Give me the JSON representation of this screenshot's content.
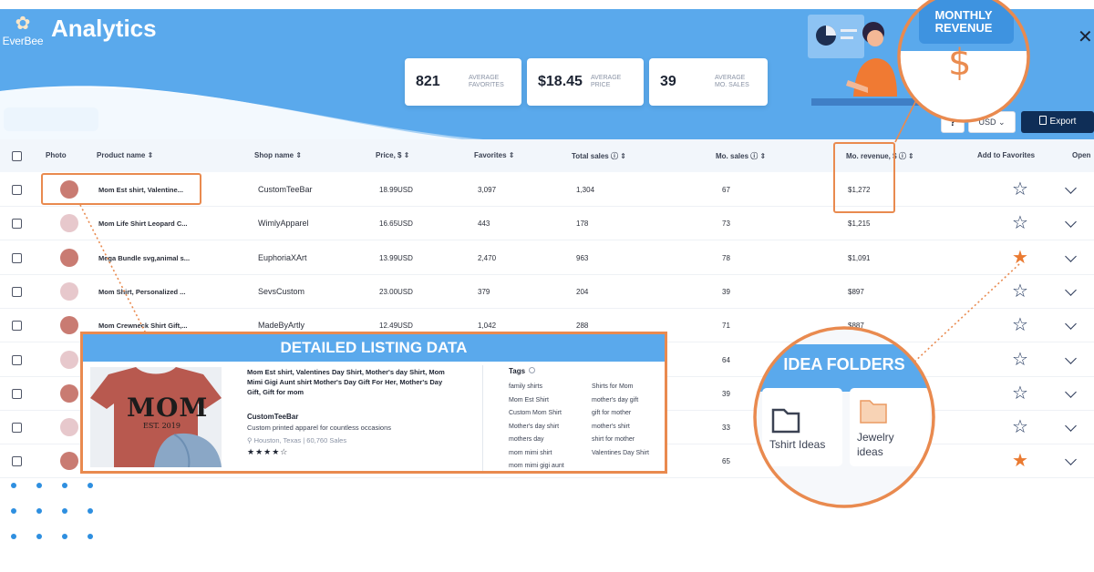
{
  "app": {
    "logo": "EverBee",
    "title": "Analytics"
  },
  "stats": [
    {
      "value": "821",
      "label": "AVERAGE FAVORITES"
    },
    {
      "value": "$18.45",
      "label": "AVERAGE PRICE"
    },
    {
      "value": "39",
      "label": "AVERAGE MO. SALES"
    }
  ],
  "toolbar": {
    "help": "?",
    "currency": "USD",
    "export": "Export"
  },
  "columns": {
    "photo": "Photo",
    "product": "Product name",
    "shop": "Shop name",
    "price": "Price, $",
    "favorites": "Favorites",
    "total_sales": "Total sales",
    "mo_sales": "Mo. sales",
    "mo_revenue": "Mo. revenue, $",
    "add_fav": "Add to Favorites",
    "open": "Open"
  },
  "rows": [
    {
      "product": "Mom Est shirt, Valentine...",
      "shop": "CustomTeeBar",
      "price": "18.99USD",
      "favorites": "3,097",
      "total_sales": "1,304",
      "mo_sales": "67",
      "revenue": "$1,272",
      "fav": false
    },
    {
      "product": "Mom Life Shirt Leopard C...",
      "shop": "WimlyApparel",
      "price": "16.65USD",
      "favorites": "443",
      "total_sales": "178",
      "mo_sales": "73",
      "revenue": "$1,215",
      "fav": false
    },
    {
      "product": "Mega Bundle svg,animal s...",
      "shop": "EuphoriaXArt",
      "price": "13.99USD",
      "favorites": "2,470",
      "total_sales": "963",
      "mo_sales": "78",
      "revenue": "$1,091",
      "fav": true
    },
    {
      "product": "Mom Shirt, Personalized ...",
      "shop": "SevsCustom",
      "price": "23.00USD",
      "favorites": "379",
      "total_sales": "204",
      "mo_sales": "39",
      "revenue": "$897",
      "fav": false
    },
    {
      "product": "Mom Crewneck Shirt Gift,...",
      "shop": "MadeByArtly",
      "price": "12.49USD",
      "favorites": "1,042",
      "total_sales": "288",
      "mo_sales": "71",
      "revenue": "$887",
      "fav": false
    },
    {
      "product": "",
      "shop": "",
      "price": "",
      "favorites": "",
      "total_sales": "",
      "mo_sales": "64",
      "revenue": "",
      "fav": false
    },
    {
      "product": "",
      "shop": "",
      "price": "",
      "favorites": "",
      "total_sales": "",
      "mo_sales": "39",
      "revenue": "",
      "fav": false
    },
    {
      "product": "",
      "shop": "",
      "price": "",
      "favorites": "",
      "total_sales": "",
      "mo_sales": "33",
      "revenue": "",
      "fav": false
    },
    {
      "product": "",
      "shop": "",
      "price": "",
      "favorites": "",
      "total_sales": "",
      "mo_sales": "65",
      "revenue": "",
      "fav": true
    }
  ],
  "callouts": {
    "monthly_revenue": "MONTHLY REVENUE",
    "dollar": "$",
    "detailed": "DETAILED LISTING DATA",
    "idea_folders": "IDEA FOLDERS",
    "folders": [
      "Tshirt Ideas",
      "Jewelry ideas"
    ]
  },
  "detail": {
    "print": "MOM",
    "print_sub": "EST. 2019",
    "title": "Mom Est shirt, Valentines Day Shirt, Mother's day Shirt, Mom Mimi Gigi Aunt shirt Mother's Day Gift For Her, Mother's Day Gift, Gift for mom",
    "shop": "CustomTeeBar",
    "desc": "Custom printed apparel for countless occasions",
    "location": "Houston, Texas",
    "sales": "60,760 Sales",
    "stars": "★★★★☆",
    "tags_label": "Tags",
    "tags": [
      "family shirts",
      "Mom Est Shirt",
      "Custom Mom Shirt",
      "Mother's day shirt",
      "mothers day",
      "mom mimi shirt",
      "mom mimi gigi aunt",
      "Shirts for Mom",
      "mother's day gift",
      "gift for mother",
      "mother's shirt",
      "shirt for mother",
      "Valentines Day Shirt"
    ]
  },
  "colors": {
    "header_blue": "#5aa9ec",
    "accent_orange": "#e98a4f",
    "star_active": "#ea7a31",
    "export_navy": "#0f2e57"
  }
}
